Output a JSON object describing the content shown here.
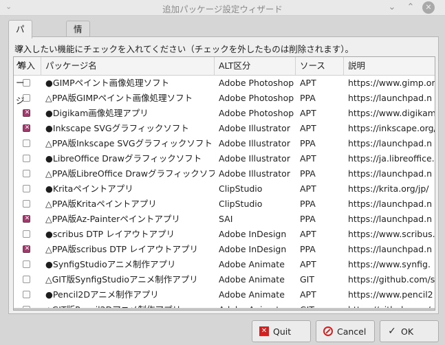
{
  "window": {
    "title": "追加パッケージ設定ウィザード",
    "menu_glyph": "⌄",
    "min_glyph": "⌄",
    "max_glyph": "⌃",
    "close_glyph": "✕"
  },
  "tabs": [
    {
      "label": "パッケージ",
      "active": true
    },
    {
      "label": "情報",
      "active": false
    }
  ],
  "instruction": "導入したい機能にチェックを入れてください（チェックを外したものは削除されます）。",
  "table": {
    "columns": [
      "導入",
      "パッケージ名",
      "ALT区分",
      "ソース",
      "説明"
    ],
    "rows": [
      {
        "checked": false,
        "name": "●GIMPペイント画像処理ソフト",
        "alt": "Adobe Photoshop",
        "source": "APT",
        "desc": "https://www.gimp.or"
      },
      {
        "checked": false,
        "name": "△PPA版GIMPペイント画像処理ソフト",
        "alt": "Adobe Photoshop",
        "source": "PPA",
        "desc": "https://launchpad.n"
      },
      {
        "checked": true,
        "name": "●Digikam画像処理アプリ",
        "alt": "Adobe Photoshop",
        "source": "APT",
        "desc": "https://www.digikam"
      },
      {
        "checked": true,
        "name": "●Inkscape SVGグラフィックソフト",
        "alt": "Adobe Illustrator",
        "source": "APT",
        "desc": "https://inkscape.org/"
      },
      {
        "checked": false,
        "name": "△PPA版Inkscape SVGグラフィックソフト",
        "alt": "Adobe Illustrator",
        "source": "PPA",
        "desc": "https://launchpad.n"
      },
      {
        "checked": false,
        "name": "●LibreOffice Drawグラフィックソフト",
        "alt": "Adobe Illustrator",
        "source": "APT",
        "desc": "https://ja.libreoffice."
      },
      {
        "checked": false,
        "name": "△PPA版LibreOffice Drawグラフィックソフト",
        "alt": "Adobe Illustrator",
        "source": "PPA",
        "desc": "https://launchpad.n"
      },
      {
        "checked": false,
        "name": "●Kritaペイントアプリ",
        "alt": "ClipStudio",
        "source": "APT",
        "desc": "https://krita.org/jp/"
      },
      {
        "checked": false,
        "name": "△PPA版Kritaペイントアプリ",
        "alt": "ClipStudio",
        "source": "PPA",
        "desc": "https://launchpad.n"
      },
      {
        "checked": true,
        "name": "△PPA版Az-Painterペイントアプリ",
        "alt": "SAI",
        "source": "PPA",
        "desc": "https://launchpad.n"
      },
      {
        "checked": false,
        "name": "●scribus DTP レイアウトアプリ",
        "alt": "Adobe InDesign",
        "source": "APT",
        "desc": "https://www.scribus."
      },
      {
        "checked": true,
        "name": "△PPA版scribus DTP レイアウトアプリ",
        "alt": "Adobe InDesign",
        "source": "PPA",
        "desc": "https://launchpad.n"
      },
      {
        "checked": false,
        "name": "●SynfigStudioアニメ制作アプリ",
        "alt": "Adobe  Animate",
        "source": "APT",
        "desc": "https://www.synfig."
      },
      {
        "checked": false,
        "name": "△GIT版SynfigStudioアニメ制作アプリ",
        "alt": "Adobe Animate",
        "source": "GIT",
        "desc": "https://github.com/s"
      },
      {
        "checked": false,
        "name": "●Pencil2Dアニメ制作アプリ",
        "alt": "Adobe  Animate",
        "source": "APT",
        "desc": "https://www.pencil2"
      },
      {
        "checked": false,
        "name": "△GIT版Pencil2Dアニメ制作アプリ",
        "alt": "Adobe  Animate",
        "source": "GIT",
        "desc": "https://github.com/"
      }
    ]
  },
  "buttons": {
    "quit": "Quit",
    "cancel": "Cancel",
    "ok": "OK"
  },
  "colors": {
    "checked_box": "#9c3d6c",
    "error_icon": "#d02020"
  }
}
